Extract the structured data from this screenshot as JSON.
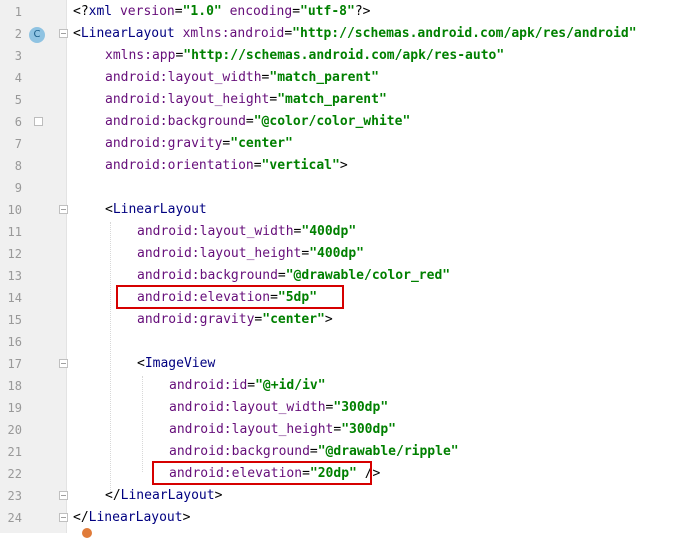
{
  "editor": {
    "lines": [
      {
        "n": "1",
        "parts": [
          [
            "punc",
            "<?"
          ],
          [
            "tag",
            "xml "
          ],
          [
            "attr",
            "version"
          ],
          [
            "punc",
            "="
          ],
          [
            "val",
            "\"1.0\""
          ],
          [
            "punc",
            " "
          ],
          [
            "attr",
            "encoding"
          ],
          [
            "punc",
            "="
          ],
          [
            "val",
            "\"utf-8\""
          ],
          [
            "punc",
            "?>"
          ]
        ]
      },
      {
        "n": "2",
        "parts": [
          [
            "punc",
            "<"
          ],
          [
            "tag",
            "LinearLayout "
          ],
          [
            "ns",
            "xmlns:"
          ],
          [
            "attr",
            "android"
          ],
          [
            "punc",
            "="
          ],
          [
            "val",
            "\"http://schemas.android.com/apk/res/android\""
          ]
        ]
      },
      {
        "n": "3",
        "parts": [
          [
            "ns",
            "xmlns:"
          ],
          [
            "attr",
            "app"
          ],
          [
            "punc",
            "="
          ],
          [
            "val",
            "\"http://schemas.android.com/apk/res-auto\""
          ]
        ]
      },
      {
        "n": "4",
        "parts": [
          [
            "ns",
            "android:"
          ],
          [
            "attr",
            "layout_width"
          ],
          [
            "punc",
            "="
          ],
          [
            "val",
            "\"match_parent\""
          ]
        ]
      },
      {
        "n": "5",
        "parts": [
          [
            "ns",
            "android:"
          ],
          [
            "attr",
            "layout_height"
          ],
          [
            "punc",
            "="
          ],
          [
            "val",
            "\"match_parent\""
          ]
        ]
      },
      {
        "n": "6",
        "parts": [
          [
            "ns",
            "android:"
          ],
          [
            "attr",
            "background"
          ],
          [
            "punc",
            "="
          ],
          [
            "val",
            "\"@color/color_white\""
          ]
        ]
      },
      {
        "n": "7",
        "parts": [
          [
            "ns",
            "android:"
          ],
          [
            "attr",
            "gravity"
          ],
          [
            "punc",
            "="
          ],
          [
            "val",
            "\"center\""
          ]
        ]
      },
      {
        "n": "8",
        "parts": [
          [
            "ns",
            "android:"
          ],
          [
            "attr",
            "orientation"
          ],
          [
            "punc",
            "="
          ],
          [
            "val",
            "\"vertical\""
          ],
          [
            "punc",
            ">"
          ]
        ]
      },
      {
        "n": "9",
        "parts": []
      },
      {
        "n": "10",
        "parts": [
          [
            "punc",
            "<"
          ],
          [
            "tag",
            "LinearLayout"
          ]
        ]
      },
      {
        "n": "11",
        "parts": [
          [
            "ns",
            "android:"
          ],
          [
            "attr",
            "layout_width"
          ],
          [
            "punc",
            "="
          ],
          [
            "val",
            "\"400dp\""
          ]
        ]
      },
      {
        "n": "12",
        "parts": [
          [
            "ns",
            "android:"
          ],
          [
            "attr",
            "layout_height"
          ],
          [
            "punc",
            "="
          ],
          [
            "val",
            "\"400dp\""
          ]
        ]
      },
      {
        "n": "13",
        "parts": [
          [
            "ns",
            "android:"
          ],
          [
            "attr",
            "background"
          ],
          [
            "punc",
            "="
          ],
          [
            "val",
            "\"@drawable/color_red\""
          ]
        ]
      },
      {
        "n": "14",
        "parts": [
          [
            "ns",
            "android:"
          ],
          [
            "attr",
            "elevation"
          ],
          [
            "punc",
            "="
          ],
          [
            "val",
            "\"5dp\""
          ]
        ]
      },
      {
        "n": "15",
        "parts": [
          [
            "ns",
            "android:"
          ],
          [
            "attr",
            "gravity"
          ],
          [
            "punc",
            "="
          ],
          [
            "val",
            "\"center\""
          ],
          [
            "punc",
            ">"
          ]
        ]
      },
      {
        "n": "16",
        "parts": []
      },
      {
        "n": "17",
        "parts": [
          [
            "punc",
            "<"
          ],
          [
            "tag",
            "ImageView"
          ]
        ]
      },
      {
        "n": "18",
        "parts": [
          [
            "ns",
            "android:"
          ],
          [
            "attr",
            "id"
          ],
          [
            "punc",
            "="
          ],
          [
            "val",
            "\"@+id/iv\""
          ]
        ]
      },
      {
        "n": "19",
        "parts": [
          [
            "ns",
            "android:"
          ],
          [
            "attr",
            "layout_width"
          ],
          [
            "punc",
            "="
          ],
          [
            "val",
            "\"300dp\""
          ]
        ]
      },
      {
        "n": "20",
        "parts": [
          [
            "ns",
            "android:"
          ],
          [
            "attr",
            "layout_height"
          ],
          [
            "punc",
            "="
          ],
          [
            "val",
            "\"300dp\""
          ]
        ]
      },
      {
        "n": "21",
        "parts": [
          [
            "ns",
            "android:"
          ],
          [
            "attr",
            "background"
          ],
          [
            "punc",
            "="
          ],
          [
            "val",
            "\"@drawable/ripple\""
          ]
        ]
      },
      {
        "n": "22",
        "parts": [
          [
            "ns",
            "android:"
          ],
          [
            "attr",
            "elevation"
          ],
          [
            "punc",
            "="
          ],
          [
            "val",
            "\"20dp\""
          ],
          [
            "punc",
            " />"
          ]
        ]
      },
      {
        "n": "23",
        "parts": [
          [
            "punc",
            "</"
          ],
          [
            "tag",
            "LinearLayout"
          ],
          [
            "punc",
            ">"
          ]
        ]
      },
      {
        "n": "24",
        "parts": [
          [
            "punc",
            "</"
          ],
          [
            "tag",
            "LinearLayout"
          ],
          [
            "punc",
            ">"
          ]
        ]
      }
    ],
    "gutter_badge": "C",
    "colors": {
      "highlight": "#d60000",
      "tag": "#000080",
      "attr": "#660e7a",
      "value": "#008000",
      "gutter": "#f0f0f0"
    }
  }
}
